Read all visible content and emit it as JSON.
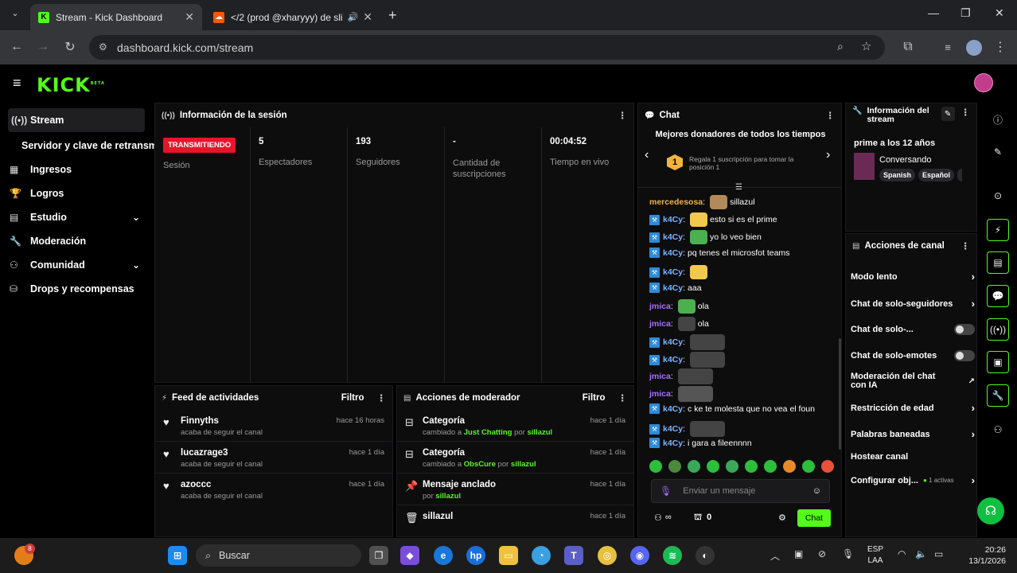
{
  "browser": {
    "tabs": [
      {
        "title": "Stream - Kick Dashboard",
        "active": true
      },
      {
        "title": "</2 (prod @xharyyy) de slir",
        "active": false
      }
    ],
    "url": "dashboard.kick.com/stream"
  },
  "kick": {
    "logo": "KICK",
    "logo_sup": "BETA"
  },
  "sidebar": {
    "items": [
      {
        "label": "Stream",
        "icon": "broadcast-icon"
      },
      {
        "label": "Servidor y clave de retransm",
        "icon": ""
      },
      {
        "label": "Ingresos",
        "icon": "grid-icon"
      },
      {
        "label": "Logros",
        "icon": "trophy-icon"
      },
      {
        "label": "Estudio",
        "icon": "studio-icon"
      },
      {
        "label": "Moderación",
        "icon": "wrench-icon"
      },
      {
        "label": "Comunidad",
        "icon": "community-icon"
      },
      {
        "label": "Drops y recompensas",
        "icon": "gift-icon"
      }
    ]
  },
  "session": {
    "title": "Información de la sesión",
    "live_badge": "TRANSMITIENDO",
    "live_label": "Sesión",
    "stats": [
      {
        "value": "5",
        "label": "Espectadores"
      },
      {
        "value": "193",
        "label": "Seguidores"
      },
      {
        "value": "-",
        "label": "Cantidad de suscripciones"
      },
      {
        "value": "00:04:52",
        "label": "Tiempo en vivo"
      }
    ]
  },
  "feed": {
    "title": "Feed de actividades",
    "filter": "Filtro",
    "rows": [
      {
        "name": "Finnyths",
        "sub": "acaba de seguir el canal",
        "time": "hace 16 horas"
      },
      {
        "name": "lucazrage3",
        "sub": "acaba de seguir el canal",
        "time": "hace 1 día"
      },
      {
        "name": "azoccc",
        "sub": "acaba de seguir el canal",
        "time": "hace 1 día"
      }
    ]
  },
  "modactions": {
    "title": "Acciones de moderador",
    "filter": "Filtro",
    "rows": [
      {
        "title": "Categoría",
        "pre": "cambiado a ",
        "hl": "Just Chatting",
        "mid": " por ",
        "user": "sillazul",
        "time": "hace 1 día"
      },
      {
        "title": "Categoría",
        "pre": "cambiado a ",
        "hl": "ObsCure",
        "mid": " por ",
        "user": "sillazul",
        "time": "hace 1 día"
      },
      {
        "title": "Mensaje anclado",
        "pre": "por ",
        "hl": "",
        "mid": "",
        "user": "sillazul",
        "time": "hace 1 día"
      },
      {
        "title": "sillazul",
        "pre": "",
        "hl": "",
        "mid": "",
        "user": "",
        "time": "hace 1 día"
      }
    ]
  },
  "chat": {
    "title": "Chat",
    "donors_title": "Mejores donadores de todos los tiempos",
    "donor_rank": "1",
    "donor_text": "Regala 1 suscripción para tomar la posición 1",
    "messages": [
      {
        "user": "mercedesosa",
        "text": "sillazul",
        "cls": "u3",
        "badge": false
      },
      {
        "user": "k4Cy",
        "text": "esto si es el prime",
        "cls": "u1",
        "badge": true
      },
      {
        "user": "k4Cy",
        "text": "yo lo veo bien",
        "cls": "u1",
        "badge": true
      },
      {
        "user": "k4Cy",
        "text": "pq tenes el microsfot teams",
        "cls": "u1",
        "badge": true
      },
      {
        "user": "k4Cy",
        "text": "",
        "cls": "u1",
        "badge": true
      },
      {
        "user": "k4Cy",
        "text": "aaa",
        "cls": "u1",
        "badge": true
      },
      {
        "user": "jmica",
        "text": "ola",
        "cls": "u2",
        "badge": false
      },
      {
        "user": "jmica",
        "text": "ola",
        "cls": "u2",
        "badge": false
      },
      {
        "user": "k4Cy",
        "text": "",
        "cls": "u1",
        "badge": true
      },
      {
        "user": "k4Cy",
        "text": "",
        "cls": "u1",
        "badge": true
      },
      {
        "user": "jmica",
        "text": "",
        "cls": "u2",
        "badge": false
      },
      {
        "user": "jmica",
        "text": "",
        "cls": "u2",
        "badge": false
      },
      {
        "user": "k4Cy",
        "text": "c ke te molesta que no vea el foun",
        "cls": "u1",
        "badge": true
      },
      {
        "user": "k4Cy",
        "text": "",
        "cls": "u1",
        "badge": true
      },
      {
        "user": "k4Cy",
        "text": "i gara a fileennnn",
        "cls": "u1",
        "badge": true
      }
    ],
    "input_placeholder": "Enviar un mensaje",
    "viewers": "∞",
    "store_count": "0",
    "send_label": "Chat"
  },
  "streaminfo": {
    "title": "Información del stream",
    "stream_title": "prime a los 12 años",
    "category": "Conversando",
    "tags": [
      "Spanish",
      "Español"
    ]
  },
  "channel_actions": {
    "title": "Acciones de canal",
    "rows": [
      {
        "label": "Modo lento",
        "kind": "arrow"
      },
      {
        "label": "Chat de solo-seguidores",
        "kind": "arrow"
      },
      {
        "label": "Chat de solo-...",
        "kind": "toggle"
      },
      {
        "label": "Chat de solo-emotes",
        "kind": "toggle"
      },
      {
        "label": "Moderación del chat con IA",
        "kind": "ext"
      },
      {
        "label": "Restricción de edad",
        "kind": "arrow"
      },
      {
        "label": "Palabras baneadas",
        "kind": "arrow"
      },
      {
        "label": "Hostear canal",
        "kind": "none"
      },
      {
        "label": "Configurar obj...",
        "kind": "arrow",
        "extra": "1 activas"
      }
    ]
  },
  "taskbar": {
    "search": "Buscar",
    "notif_count": "8",
    "lang": "ESP",
    "lang2": "LAA",
    "time": "20:26",
    "date": "13/1/2026"
  }
}
